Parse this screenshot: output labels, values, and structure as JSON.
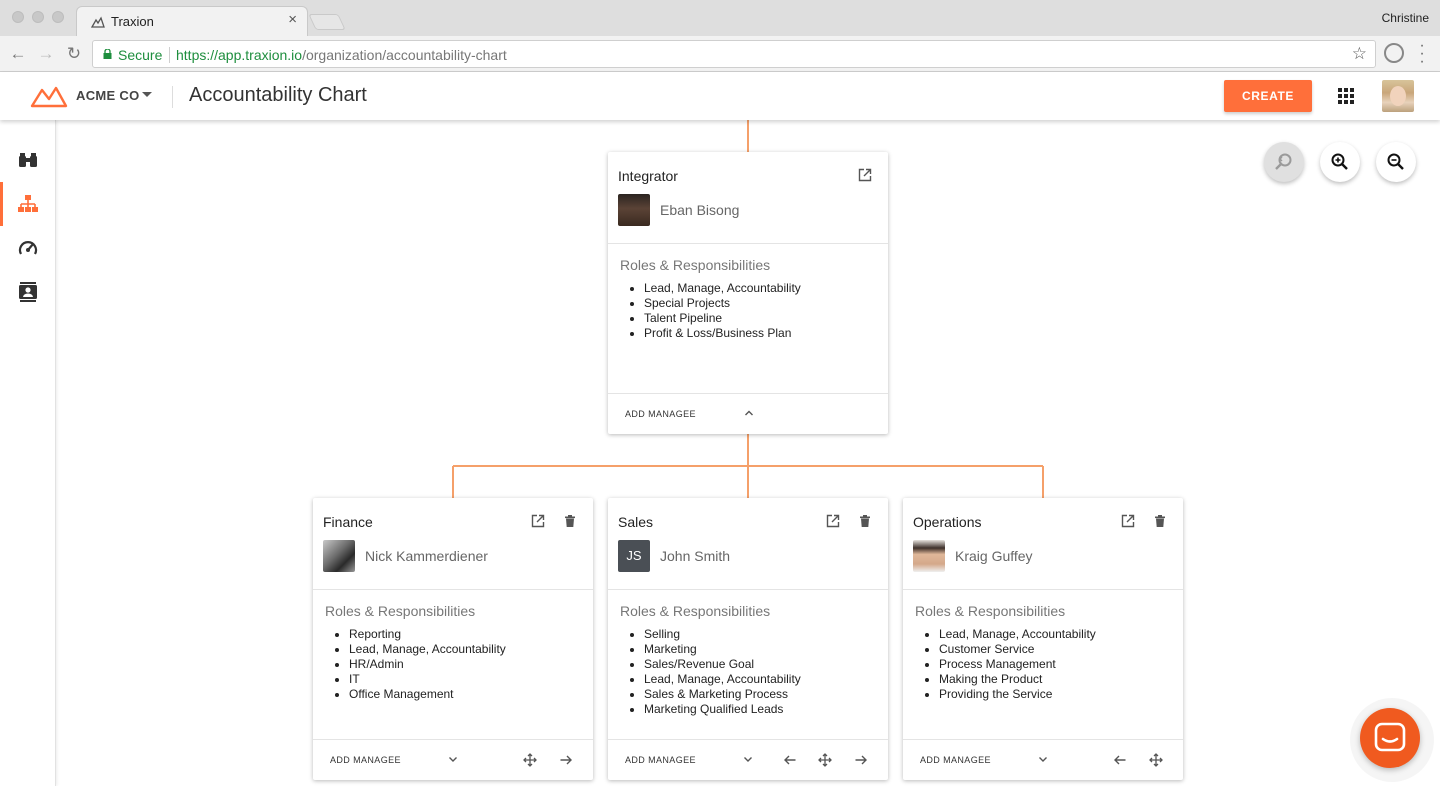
{
  "browser": {
    "tab_title": "Traxion",
    "tab_close": "×",
    "user_name": "Christine",
    "secure_label": "Secure",
    "url_host": "https://app.traxion.io",
    "url_path": "/organization/accountability-chart"
  },
  "header": {
    "org_name": "ACME CO",
    "page_title": "Accountability Chart",
    "create_label": "CREATE",
    "brand_color": "#ff6f3a"
  },
  "sidebar": {
    "items": [
      {
        "icon": "binoculars-icon",
        "active": false
      },
      {
        "icon": "org-chart-icon",
        "active": true
      },
      {
        "icon": "speedometer-icon",
        "active": false
      },
      {
        "icon": "contact-card-icon",
        "active": false
      }
    ]
  },
  "zoom": {
    "icons": [
      "zoom-reset-icon",
      "zoom-in-icon",
      "zoom-out-icon"
    ]
  },
  "cards": {
    "integrator": {
      "title": "Integrator",
      "person": "Eban Bisong",
      "roles_heading": "Roles & Responsibilities",
      "roles": [
        "Lead, Manage, Accountability",
        "Special Projects",
        "Talent Pipeline",
        "Profit & Loss/Business Plan"
      ],
      "add_label": "ADD MANAGEE"
    },
    "finance": {
      "title": "Finance",
      "person": "Nick Kammerdiener",
      "roles_heading": "Roles & Responsibilities",
      "roles": [
        "Reporting",
        "Lead, Manage, Accountability",
        "HR/Admin",
        "IT",
        "Office Management"
      ],
      "add_label": "ADD MANAGEE"
    },
    "sales": {
      "title": "Sales",
      "person": "John Smith",
      "initials": "JS",
      "roles_heading": "Roles & Responsibilities",
      "roles": [
        "Selling",
        "Marketing",
        "Sales/Revenue Goal",
        "Lead, Manage, Accountability",
        "Sales & Marketing Process",
        "Marketing Qualified Leads"
      ],
      "add_label": "ADD MANAGEE"
    },
    "operations": {
      "title": "Operations",
      "person": "Kraig Guffey",
      "roles_heading": "Roles & Responsibilities",
      "roles": [
        "Lead, Manage, Accountability",
        "Customer Service",
        "Process Management",
        "Making the Product",
        "Providing the Service"
      ],
      "add_label": "ADD MANAGEE"
    }
  }
}
